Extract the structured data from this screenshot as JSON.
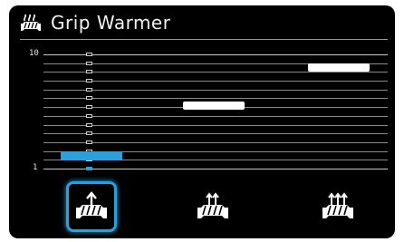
{
  "header": {
    "title": "Grip Warmer",
    "icon": "grip-warmer-icon"
  },
  "scale": {
    "max_label": "10",
    "min_label": "1",
    "max": 10,
    "min": 1
  },
  "current_level": 1,
  "modes": [
    {
      "name": "low",
      "icon": "grip-heat-low-icon",
      "level": 1,
      "selected": true
    },
    {
      "name": "medium",
      "icon": "grip-heat-medium-icon",
      "level": 6,
      "selected": false
    },
    {
      "name": "high",
      "icon": "grip-heat-high-icon",
      "level": 9,
      "selected": false
    }
  ],
  "colors": {
    "accent": "#2aa1de",
    "foreground": "#ffffff",
    "background": "#000000"
  }
}
